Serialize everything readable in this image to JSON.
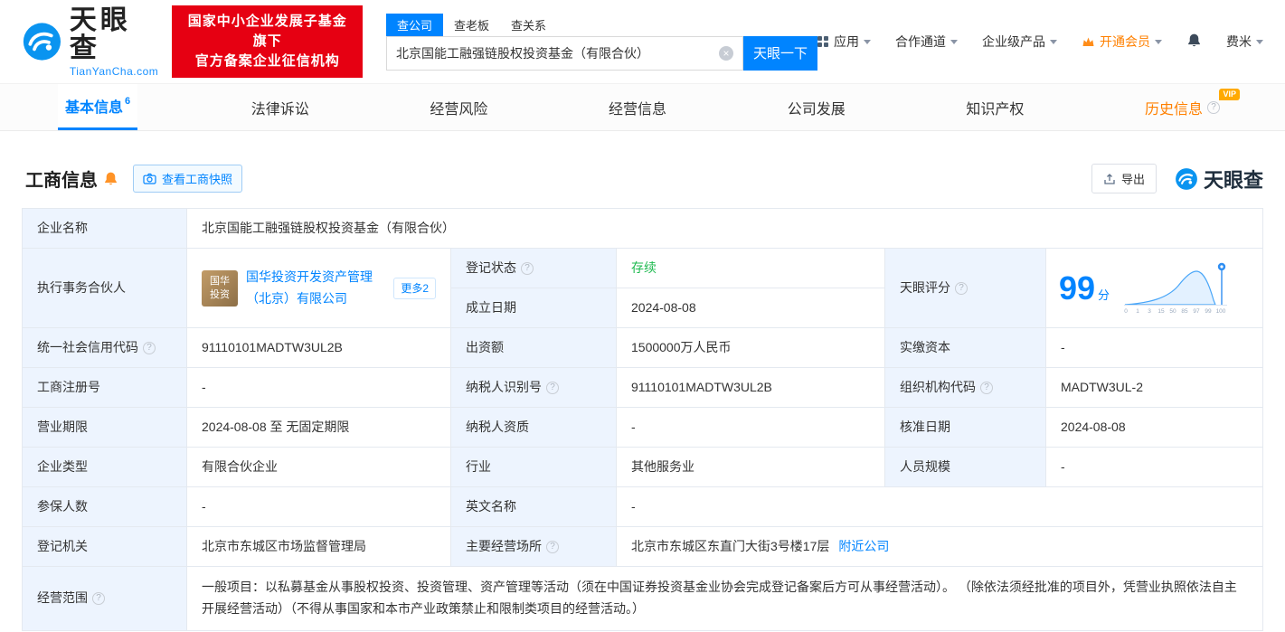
{
  "brand": {
    "name": "天眼查",
    "domain": "TianYanCha.com",
    "badge_line1": "国家中小企业发展子基金旗下",
    "badge_line2": "官方备案企业征信机构"
  },
  "search": {
    "tab_company": "查公司",
    "tab_boss": "查老板",
    "tab_relation": "查关系",
    "value": "北京国能工融强链股权投资基金（有限合伙）",
    "button": "天眼一下"
  },
  "nav": {
    "apps": "应用",
    "cooperation": "合作通道",
    "enterprise": "企业级产品",
    "vip": "开通会员",
    "user": "费米"
  },
  "tabs": {
    "basic": {
      "label": "基本信息",
      "count": "6"
    },
    "legal": "法律诉讼",
    "risk": "经营风险",
    "operation": "经营信息",
    "development": "公司发展",
    "ip": "知识产权",
    "history": {
      "label": "历史信息",
      "vip": "VIP"
    }
  },
  "section": {
    "title": "工商信息",
    "snapshot": "查看工商快照",
    "export": "导出",
    "watermark": "天眼查"
  },
  "score": {
    "label": "天眼评分",
    "value": "99",
    "unit": "分",
    "ticks": [
      "0",
      "1",
      "3",
      "15",
      "50",
      "85",
      "97",
      "99",
      "100"
    ]
  },
  "fields": {
    "company_name": {
      "label": "企业名称",
      "value": "北京国能工融强链股权投资基金（有限合伙）"
    },
    "partner": {
      "label": "执行事务合伙人",
      "logo1": "国华",
      "logo2": "投资",
      "name": "国华投资开发资产管理（北京）有限公司",
      "more": "更多2"
    },
    "reg_status": {
      "label": "登记状态",
      "value": "存续"
    },
    "establish_date": {
      "label": "成立日期",
      "value": "2024-08-08"
    },
    "credit_code": {
      "label": "统一社会信用代码",
      "value": "91110101MADTW3UL2B"
    },
    "capital": {
      "label": "出资额",
      "value": "1500000万人民币"
    },
    "paid_capital": {
      "label": "实缴资本",
      "value": "-"
    },
    "reg_number": {
      "label": "工商注册号",
      "value": "-"
    },
    "taxpayer_id": {
      "label": "纳税人识别号",
      "value": "91110101MADTW3UL2B"
    },
    "org_code": {
      "label": "组织机构代码",
      "value": "MADTW3UL-2"
    },
    "business_term": {
      "label": "营业期限",
      "value": "2024-08-08 至 无固定期限"
    },
    "taxpayer_quality": {
      "label": "纳税人资质",
      "value": "-"
    },
    "approval_date": {
      "label": "核准日期",
      "value": "2024-08-08"
    },
    "company_type": {
      "label": "企业类型",
      "value": "有限合伙企业"
    },
    "industry": {
      "label": "行业",
      "value": "其他服务业"
    },
    "staff_size": {
      "label": "人员规模",
      "value": "-"
    },
    "insured_count": {
      "label": "参保人数",
      "value": "-"
    },
    "english_name": {
      "label": "英文名称",
      "value": "-"
    },
    "reg_authority": {
      "label": "登记机关",
      "value": "北京市东城区市场监督管理局"
    },
    "premises": {
      "label": "主要经营场所",
      "value": "北京市东城区东直门大街3号楼17层",
      "link": "附近公司"
    },
    "business_scope": {
      "label": "经营范围",
      "value": "一般项目：以私募基金从事股权投资、投资管理、资产管理等活动（须在中国证券投资基金业协会完成登记备案后方可从事经营活动）。 （除依法须经批准的项目外，凭营业执照依法自主开展经营活动）（不得从事国家和本市产业政策禁止和限制类项目的经营活动。）"
    }
  }
}
